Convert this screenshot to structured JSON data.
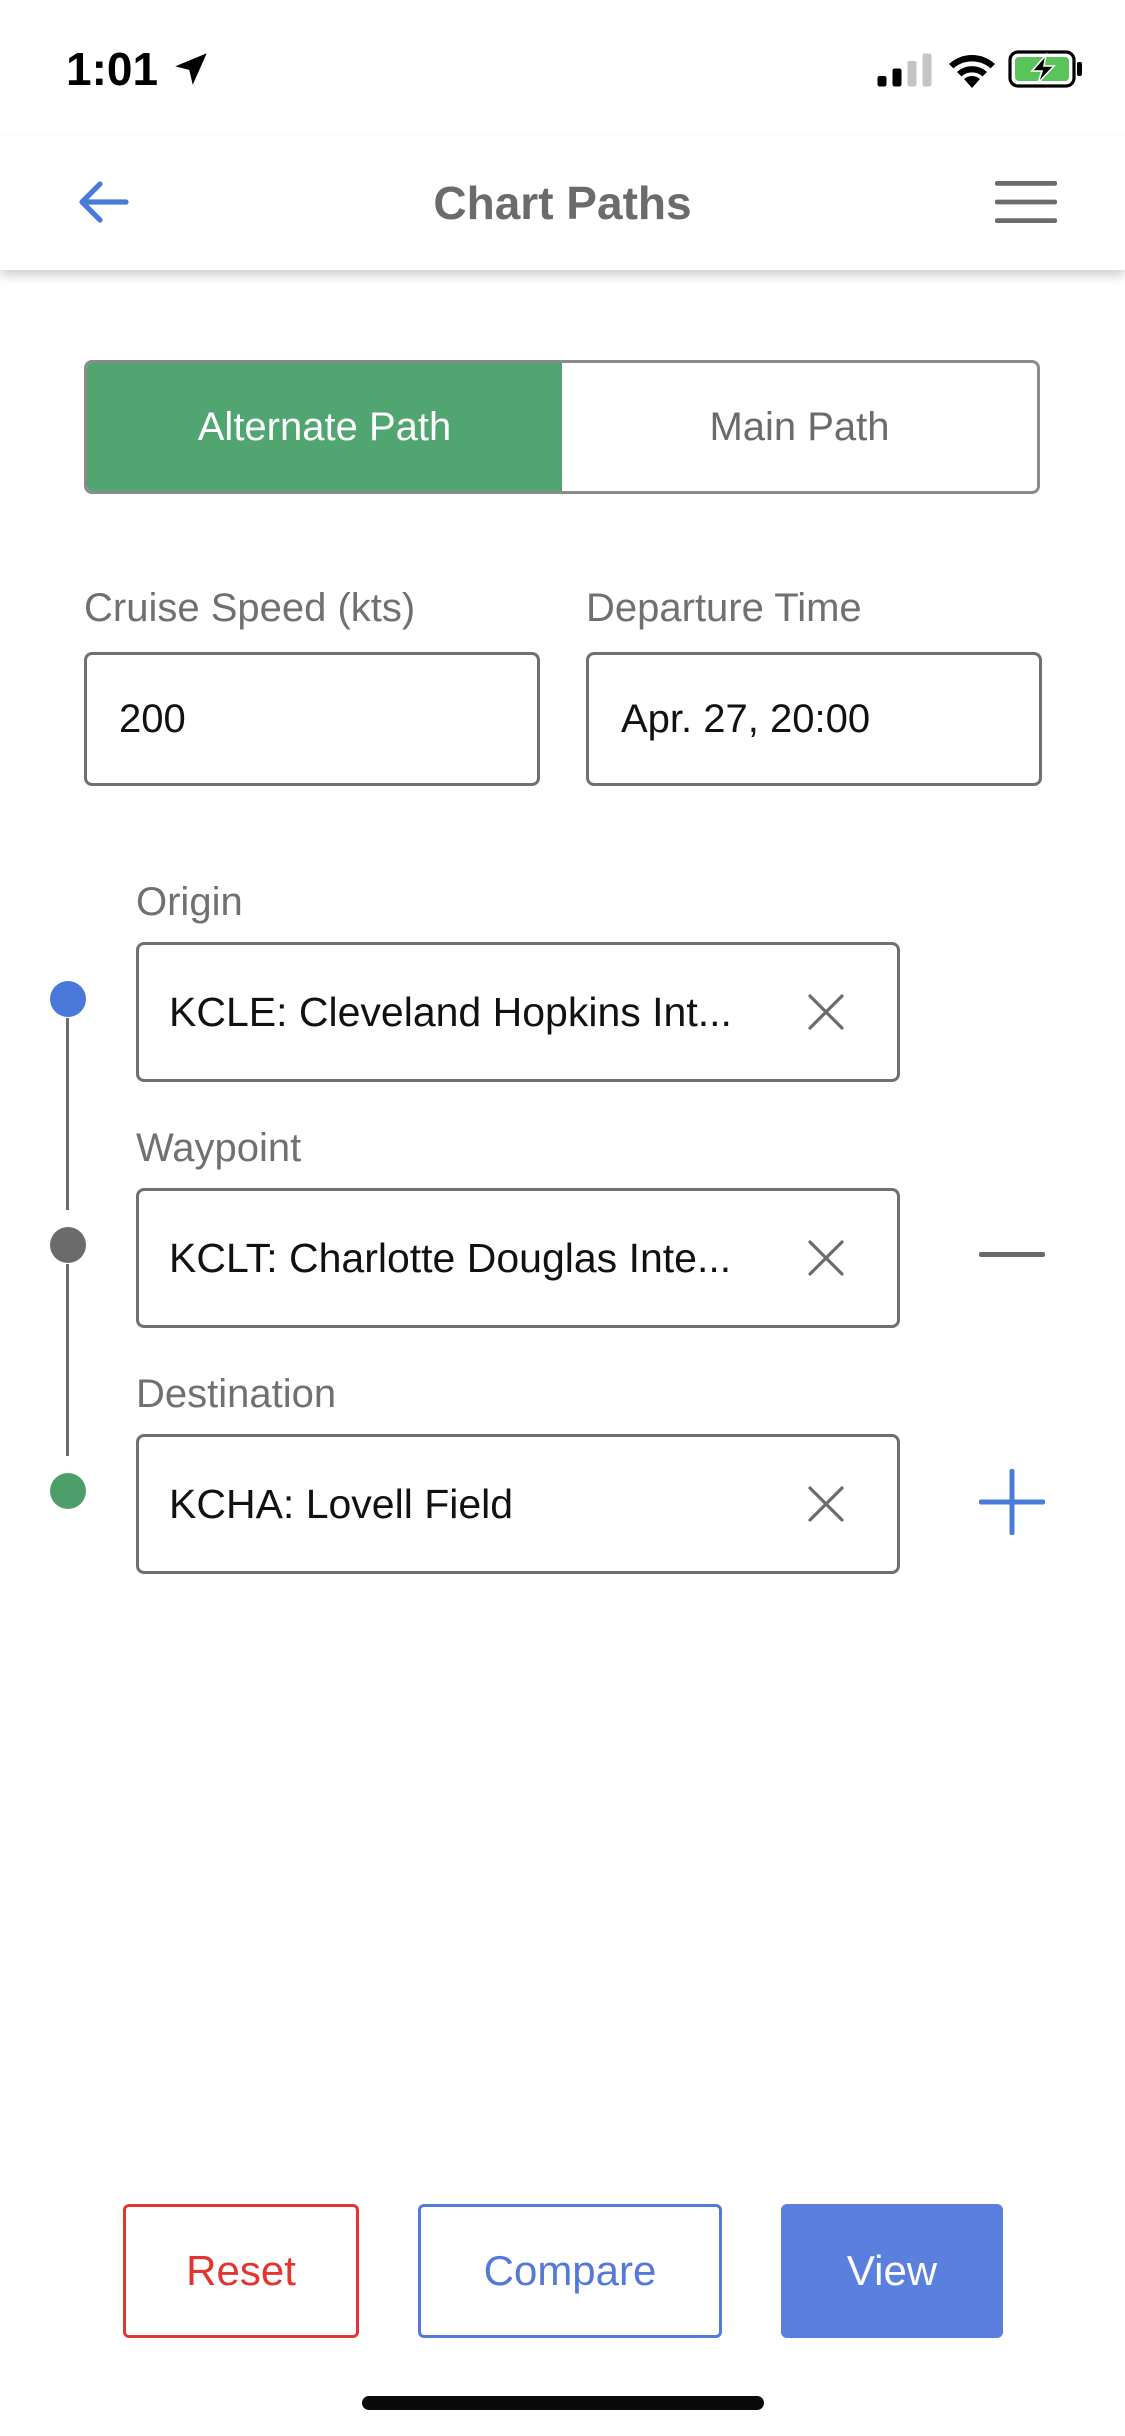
{
  "status_bar": {
    "time": "1:01",
    "icons": [
      "location-arrow-icon",
      "cellular-signal-icon",
      "wifi-icon",
      "battery-charging-icon"
    ],
    "battery_color": "#5ac35a"
  },
  "header": {
    "title": "Chart Paths",
    "back_icon": "arrow-left-icon",
    "menu_icon": "hamburger-menu-icon",
    "accent_color": "#4a7bd8"
  },
  "path_tabs": {
    "items": [
      {
        "label": "Alternate Path",
        "active": true
      },
      {
        "label": "Main Path",
        "active": false
      }
    ],
    "active_color": "#50a570"
  },
  "flight": {
    "cruise_speed_label": "Cruise Speed (kts)",
    "cruise_speed_value": "200",
    "departure_time_label": "Departure Time",
    "departure_time_value": "Apr. 27, 20:00"
  },
  "route": {
    "stops": [
      {
        "label": "Origin",
        "value": "KCLE: Cleveland Hopkins Int...",
        "dot_color": "#4a78da",
        "clear_icon": "close-x-icon"
      },
      {
        "label": "Waypoint",
        "value": "KCLT: Charlotte Douglas Inte...",
        "dot_color": "#6b6b6b",
        "clear_icon": "close-x-icon",
        "action_icon": "minus-icon"
      },
      {
        "label": "Destination",
        "value": "KCHA: Lovell Field",
        "dot_color": "#4e9e6c",
        "clear_icon": "close-x-icon",
        "action_icon": "plus-icon"
      }
    ]
  },
  "actions": {
    "reset_label": "Reset",
    "compare_label": "Compare",
    "view_label": "View",
    "reset_color": "#e0362f",
    "compare_color": "#5579d9",
    "view_color": "#5b7fdf"
  }
}
